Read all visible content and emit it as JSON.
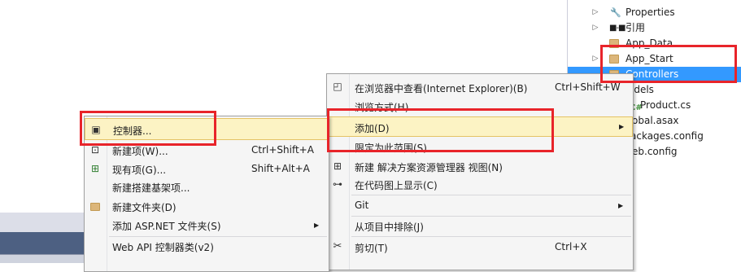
{
  "solution_tree": [
    {
      "label": "Properties",
      "icon": "wrench-icon",
      "expander": "▷"
    },
    {
      "label": "引用",
      "icon": "references-icon",
      "expander": "▷"
    },
    {
      "label": "App_Data",
      "icon": "folder-icon",
      "expander": ""
    },
    {
      "label": "App_Start",
      "icon": "folder-icon",
      "expander": "▷"
    },
    {
      "label": "Controllers",
      "icon": "folder-icon",
      "expander": "",
      "selected": true
    },
    {
      "label": "odels",
      "icon": "folder-icon",
      "expander": ""
    },
    {
      "label": "Product.cs",
      "icon": "csharp-file-icon",
      "expander": ""
    },
    {
      "label": "obal.asax",
      "icon": "file-icon",
      "expander": ""
    },
    {
      "label": "ackages.config",
      "icon": "file-icon",
      "expander": ""
    },
    {
      "label": "eb.config",
      "icon": "file-icon",
      "expander": ""
    }
  ],
  "context_menu": {
    "items": [
      {
        "label": "在浏览器中查看(Internet Explorer)(B)",
        "shortcut": "Ctrl+Shift+W",
        "icon": "browser-view-icon"
      },
      {
        "label": "浏览方式(H)...",
        "shortcut": "",
        "icon": ""
      },
      {
        "label": "添加(D)",
        "shortcut": "",
        "icon": "",
        "submenu": true,
        "highlighted": true
      },
      {
        "label": "限定为此范围(S)",
        "shortcut": "",
        "icon": ""
      },
      {
        "label": "新建 解决方案资源管理器 视图(N)",
        "shortcut": "",
        "icon": "new-view-icon"
      },
      {
        "label": "在代码图上显示(C)",
        "shortcut": "",
        "icon": "code-map-icon"
      },
      {
        "label": "Git",
        "shortcut": "",
        "icon": "",
        "submenu": true
      },
      {
        "label": "从项目中排除(J)",
        "shortcut": "",
        "icon": ""
      },
      {
        "label": "剪切(T)",
        "shortcut": "Ctrl+X",
        "icon": "cut-icon"
      }
    ]
  },
  "add_submenu": {
    "items": [
      {
        "label": "控制器...",
        "shortcut": "",
        "icon": "controller-icon",
        "highlighted": true
      },
      {
        "label": "新建项(W)...",
        "shortcut": "Ctrl+Shift+A",
        "icon": "new-item-icon"
      },
      {
        "label": "现有项(G)...",
        "shortcut": "Shift+Alt+A",
        "icon": "existing-item-icon"
      },
      {
        "label": "新建搭建基架项...",
        "shortcut": "",
        "icon": ""
      },
      {
        "label": "新建文件夹(D)",
        "shortcut": "",
        "icon": "new-folder-icon"
      },
      {
        "label": "添加 ASP.NET 文件夹(S)",
        "shortcut": "",
        "icon": "",
        "submenu": true
      },
      {
        "label": "Web API 控制器类(v2)",
        "shortcut": "",
        "icon": ""
      }
    ]
  },
  "colors": {
    "selection": "#3399ff",
    "menu_highlight": "#fcf3c4",
    "annotation": "#e8242a"
  }
}
